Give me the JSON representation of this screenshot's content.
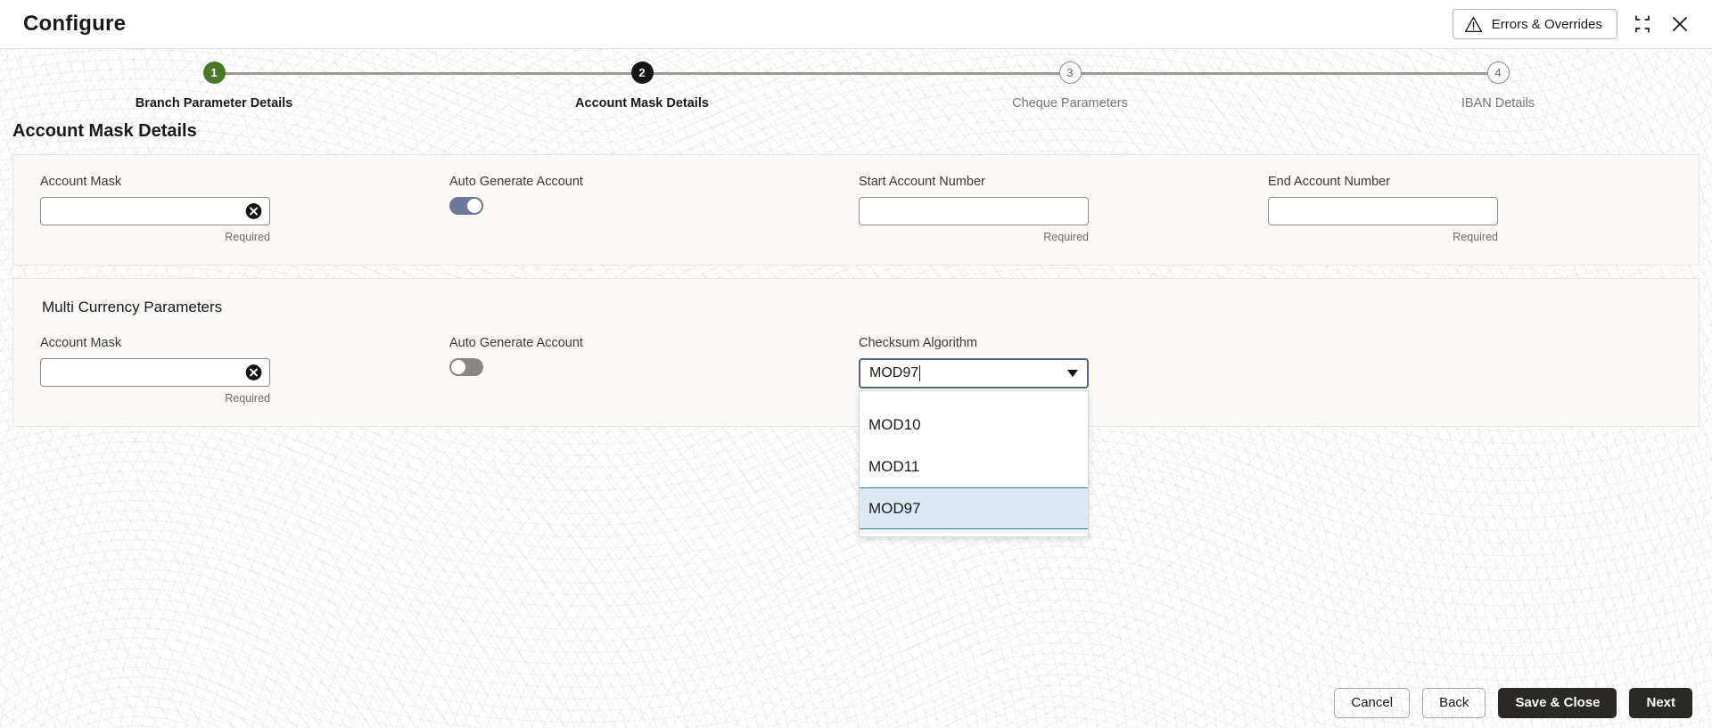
{
  "window": {
    "title": "Configure",
    "errors_button": "Errors & Overrides",
    "minimize_icon": "collapse-icon",
    "close_icon": "close-icon"
  },
  "stepper": {
    "steps": [
      {
        "number": "1",
        "label": "Branch Parameter Details",
        "state": "done"
      },
      {
        "number": "2",
        "label": "Account Mask Details",
        "state": "current"
      },
      {
        "number": "3",
        "label": "Cheque Parameters",
        "state": "todo"
      },
      {
        "number": "4",
        "label": "IBAN Details",
        "state": "todo"
      }
    ]
  },
  "page": {
    "heading": "Account Mask Details"
  },
  "section_main": {
    "account_mask": {
      "label": "Account Mask",
      "value": "",
      "hint": "Required",
      "clear_icon": "clear-circle-icon"
    },
    "auto_generate": {
      "label": "Auto Generate Account",
      "state": "on"
    },
    "start_account": {
      "label": "Start Account Number",
      "value": "",
      "hint": "Required"
    },
    "end_account": {
      "label": "End Account Number",
      "value": "",
      "hint": "Required"
    }
  },
  "section_multi": {
    "title": "Multi Currency Parameters",
    "account_mask": {
      "label": "Account Mask",
      "value": "",
      "hint": "Required",
      "clear_icon": "clear-circle-icon"
    },
    "auto_generate": {
      "label": "Auto Generate Account",
      "state": "off"
    },
    "checksum": {
      "label": "Checksum Algorithm",
      "value": "MOD97",
      "expanded": true,
      "options": [
        "MOD10",
        "MOD11",
        "MOD97"
      ],
      "selected": "MOD97"
    }
  },
  "footer": {
    "cancel": "Cancel",
    "back": "Back",
    "save_close": "Save & Close",
    "next": "Next"
  },
  "colors": {
    "step_done": "#4a7729",
    "step_current": "#161513",
    "toggle_on": "#6b7898",
    "toggle_off": "#8a8781",
    "dropdown_selected_bg": "#dbeaf3",
    "dropdown_selected_border": "#2f7c99",
    "combo_focus_border": "#5a6480",
    "primary_button": "#2b2926"
  }
}
